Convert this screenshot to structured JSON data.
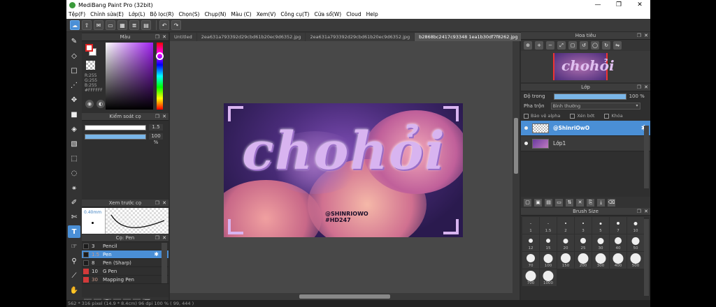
{
  "window": {
    "title": "MediBang Paint Pro (32bit)",
    "min": "—",
    "max": "❐",
    "close": "✕"
  },
  "menu": [
    "Tệp(F)",
    "Chỉnh sửa(E)",
    "Lớp(L)",
    "Bộ lọc(R)",
    "Chọn(S)",
    "Chụp(N)",
    "Màu (C)",
    "Xem(V)",
    "Công cụ(T)",
    "Cửa sổ(W)",
    "Cloud",
    "Help"
  ],
  "icons": {
    "close": "✕",
    "float": "❐",
    "gear": "✱"
  },
  "color_panel": {
    "title": "Màu",
    "r": "R:255",
    "g": "G:255",
    "b": "B:255",
    "hex": "#FFFFFF"
  },
  "brush_control": {
    "title": "Kiểm soát cọ",
    "size": "1.5",
    "opacity": "100 %"
  },
  "brush_preview": {
    "title": "Xem trước cọ",
    "size_label": "0.40mm"
  },
  "pen_panel": {
    "title": "Cọ: Pen",
    "items": [
      {
        "num": "3",
        "name": "Pencil",
        "color": "dark"
      },
      {
        "num": "1.5",
        "name": "Pen",
        "color": "dark"
      },
      {
        "num": "8",
        "name": "Pen (Sharp)",
        "color": "dark"
      },
      {
        "num": "10",
        "name": "G Pen",
        "color": "red"
      },
      {
        "num": "30",
        "name": "Mapping Pen",
        "color": "red"
      }
    ]
  },
  "tabs": [
    "Untitled",
    "2ea631a793392d29cbd61b20ec9d6352.jpg",
    "2ea631a793392d29cbd61b20ec9d6352.jpg",
    "b2868bc2417c93348 1ea1b30df7f8262.jpg"
  ],
  "artwork": {
    "text": "chohỏi",
    "handle1": "@SHINRIOWO",
    "handle2": "#HD247"
  },
  "navigator": {
    "title": "Hoa tiêu",
    "thumb_text": "chohỏi"
  },
  "layer_panel": {
    "title": "Lớp",
    "opacity_label": "Độ trong",
    "opacity_value": "100 %",
    "blend_label": "Pha trộn",
    "blend_value": "Bình thường",
    "protect_alpha": "Bảo vệ alpha",
    "clip": "Xén bớt",
    "lock": "Khóa",
    "layers": [
      "@ShinriOwO",
      "Lớp1"
    ]
  },
  "brush_size": {
    "title": "Brush Size",
    "sizes": [
      "1",
      "1.5",
      "2",
      "3",
      "5",
      "7",
      "10",
      "12",
      "15",
      "20",
      "25",
      "30",
      "40",
      "50",
      "70",
      "100",
      "150",
      "200",
      "300",
      "400",
      "500",
      "700",
      "1000"
    ]
  },
  "status": "562 * 316 pixel  (14.9 * 8.4cm)  96 dpi  100 %  ( 99, 444 )"
}
